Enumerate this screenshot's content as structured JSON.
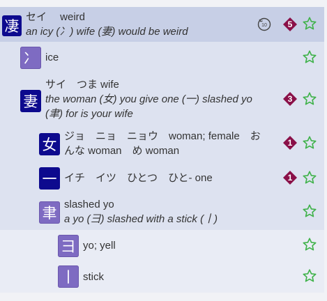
{
  "colors": {
    "accent_navy": "#0d0a8e",
    "accent_lavender": "#7e6bc2",
    "badge_maroon": "#8a1048",
    "star_green": "#3fb24a",
    "row0_bg": "#c7cfe6",
    "row1_bg": "#dde2f0",
    "row2_bg": "#e9ecf5"
  },
  "entries": [
    {
      "kanji": "凄",
      "readings": "セイ　 weird",
      "mnemonic": "an icy (冫) wife (妻) would be weird",
      "frequency": "5",
      "icon": "clock-rewind-icon"
    },
    {
      "kanji": "冫",
      "meaning": "ice"
    },
    {
      "kanji": "妻",
      "readings": "サイ　つま wife",
      "mnemonic_line1": "the woman (女) you give one (一) slashed yo",
      "mnemonic_line2": "(聿) for is your wife",
      "frequency": "3"
    },
    {
      "kanji": "女",
      "line1": "ジョ　ニョ　ニョウ　woman; female　お",
      "line2": "んな woman　め woman",
      "frequency": "1"
    },
    {
      "kanji": "一",
      "line1": "イチ　イツ　ひとつ　ひと- one",
      "frequency": "1"
    },
    {
      "kanji": "聿",
      "line1": "slashed yo",
      "line2": "a yo (彐) slashed with a stick (丨)"
    },
    {
      "kanji": "彐",
      "meaning": "yo; yell"
    },
    {
      "kanji": "丨",
      "meaning": "stick"
    }
  ]
}
